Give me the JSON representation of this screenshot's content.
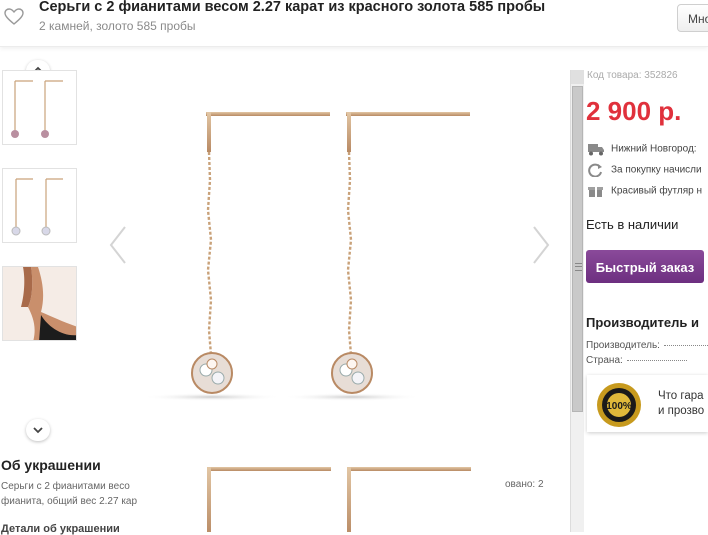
{
  "header": {
    "title": "Серьги с 2 фианитами весом 2.27 карат из красного золота 585 пробы",
    "subtitle": "2 камней, золото 585 пробы",
    "more_button": "Мно"
  },
  "icons": {
    "favorite": "heart-icon",
    "thumbs_up": "chevron-up-icon",
    "thumbs_down": "chevron-down-icon",
    "prev": "chevron-left-icon",
    "next": "chevron-right-icon",
    "delivery": "truck-icon",
    "bonus": "refresh-icon",
    "gift": "gift-icon",
    "guarantee": "seal-100-icon"
  },
  "colors": {
    "price": "#e0313c",
    "button": "#7a3a8c",
    "gold": "#c9a27a"
  },
  "about": {
    "title": "Об украшении",
    "text": "Серьги с 2 фианитами весо фианита, общий вес 2.27 кар",
    "text_right": "овано: 2",
    "details": "Детали об украшении"
  },
  "product": {
    "code": "Код товара: 352826",
    "price": "2 900 р.",
    "delivery": "Нижний Новгород:",
    "bonus": "За покупку начисли",
    "gift": "Красивый футляр н",
    "stock": "Есть в наличии",
    "quick_order": "Быстрый заказ",
    "manufacturer_title": "Производитель и",
    "manufacturer_label": "Производитель:",
    "country_label": "Страна:",
    "guarantee_line1": "Что гара",
    "guarantee_line2": "и прозво"
  }
}
